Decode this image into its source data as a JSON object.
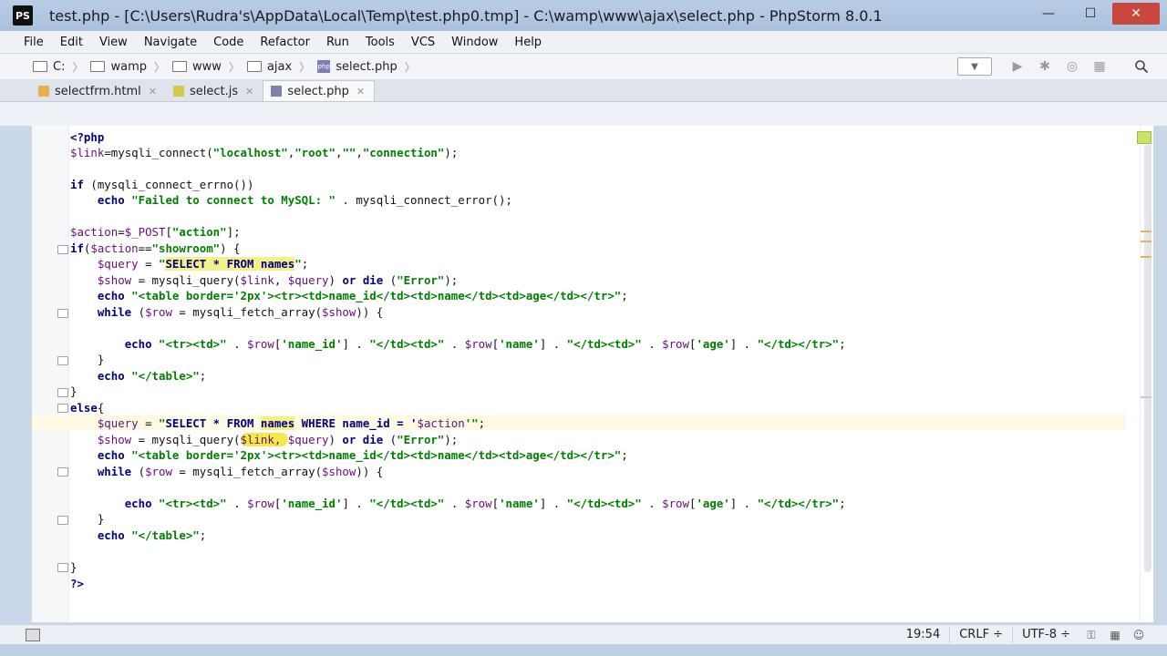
{
  "window": {
    "title": "test.php - [C:\\Users\\Rudra's\\AppData\\Local\\Temp\\test.php0.tmp] - C:\\wamp\\www\\ajax\\select.php - PhpStorm 8.0.1",
    "logo": "PS",
    "controls": {
      "minimize": "—",
      "maximize": "☐",
      "close": "✕"
    }
  },
  "menu": [
    "File",
    "Edit",
    "View",
    "Navigate",
    "Code",
    "Refactor",
    "Run",
    "Tools",
    "VCS",
    "Window",
    "Help"
  ],
  "breadcrumbs": [
    "C:",
    "wamp",
    "www",
    "ajax",
    "select.php"
  ],
  "tabs": [
    {
      "label": "selectfrm.html",
      "icon": "html-file-icon",
      "active": false
    },
    {
      "label": "select.js",
      "icon": "js-file-icon",
      "active": false
    },
    {
      "label": "select.php",
      "icon": "php-file-icon",
      "active": true
    }
  ],
  "code": {
    "l1": "<?php",
    "l2a": "$link",
    "l2b": "=mysqli_connect(",
    "l2c": "\"localhost\"",
    "l2d": ",",
    "l2e": "\"root\"",
    "l2f": ",",
    "l2g": "\"\"",
    "l2h": ",",
    "l2i": "\"connection\"",
    "l2j": ");",
    "l4a": "if",
    "l4b": " (mysqli_connect_errno())",
    "l5a": "    ",
    "l5b": "echo",
    "l5c": " ",
    "l5d": "\"Failed to connect to MySQL: \"",
    "l5e": " . mysqli_connect_error();",
    "l7a": "$action",
    "l7b": "=",
    "l7c": "$_POST",
    "l7d": "[",
    "l7e": "\"action\"",
    "l7f": "];",
    "l8a": "if",
    "l8b": "(",
    "l8c": "$action",
    "l8d": "==",
    "l8e": "\"showroom\"",
    "l8f": ") {",
    "l9a": "    ",
    "l9b": "$query",
    "l9c": " = ",
    "l9d": "\"",
    "l9e": "SELECT * FROM names",
    "l9f": "\"",
    "l9g": ";",
    "l10a": "    ",
    "l10b": "$show",
    "l10c": " = mysqli_query(",
    "l10d": "$link",
    "l10e": ", ",
    "l10f": "$query",
    "l10g": ") ",
    "l10h": "or die",
    "l10i": " (",
    "l10j": "\"Error\"",
    "l10k": ");",
    "l11a": "    ",
    "l11b": "echo",
    "l11c": " ",
    "l11d": "\"<table border='2px'><tr><td>name_id</td><td>name</td><td>age</td></tr>\"",
    "l11e": ";",
    "l12a": "    ",
    "l12b": "while",
    "l12c": " (",
    "l12d": "$row",
    "l12e": " = mysqli_fetch_array(",
    "l12f": "$show",
    "l12g": ")) {",
    "l14a": "        ",
    "l14b": "echo",
    "l14c": " ",
    "l14d": "\"<tr><td>\"",
    "l14e": " . ",
    "l14f": "$row",
    "l14g": "[",
    "l14h": "'name_id'",
    "l14i": "] . ",
    "l14j": "\"</td><td>\"",
    "l14k": " . ",
    "l14l": "$row",
    "l14m": "[",
    "l14n": "'name'",
    "l14o": "] . ",
    "l14p": "\"</td><td>\"",
    "l14q": " . ",
    "l14r": "$row",
    "l14s": "[",
    "l14t": "'age'",
    "l14u": "] . ",
    "l14v": "\"</td></tr>\"",
    "l14w": ";",
    "l15": "    }",
    "l16a": "    ",
    "l16b": "echo",
    "l16c": " ",
    "l16d": "\"</table>\"",
    "l16e": ";",
    "l17": "}",
    "l18a": "else",
    "l18b": "{",
    "l19a": "    ",
    "l19b": "$query",
    "l19c": " = ",
    "l19d": "\"",
    "l19e": "SELECT * FROM ",
    "l19f": "names",
    "l19g": " WHERE name_id = '",
    "l19h": "$action",
    "l19i": "'\"",
    "l19j": ";",
    "l20a": "    ",
    "l20b": "$show",
    "l20c": " = mysqli_query(",
    "l20d": "$link, ",
    "l20e": "$query",
    "l20f": ") ",
    "l20g": "or die",
    "l20h": " (",
    "l20i": "\"Error\"",
    "l20j": ");",
    "l21a": "    ",
    "l21b": "echo",
    "l21c": " ",
    "l21d": "\"<table border='2px'><tr><td>name_id</td><td>name</td><td>age</td></tr>\"",
    "l21e": ";",
    "l22a": "    ",
    "l22b": "while",
    "l22c": " (",
    "l22d": "$row",
    "l22e": " = mysqli_fetch_array(",
    "l22f": "$show",
    "l22g": ")) {",
    "l24a": "        ",
    "l24b": "echo",
    "l24c": " ",
    "l24d": "\"<tr><td>\"",
    "l24e": " . ",
    "l24f": "$row",
    "l24g": "[",
    "l24h": "'name_id'",
    "l24i": "] . ",
    "l24j": "\"</td><td>\"",
    "l24k": " . ",
    "l24l": "$row",
    "l24m": "[",
    "l24n": "'name'",
    "l24o": "] . ",
    "l24p": "\"</td><td>\"",
    "l24q": " . ",
    "l24r": "$row",
    "l24s": "[",
    "l24t": "'age'",
    "l24u": "] . ",
    "l24v": "\"</td></tr>\"",
    "l24w": ";",
    "l25": "    }",
    "l26a": "    ",
    "l26b": "echo",
    "l26c": " ",
    "l26d": "\"</table>\"",
    "l26e": ";",
    "l28": "}",
    "l29": "?>"
  },
  "status": {
    "position": "19:54",
    "line_separator": "CRLF ÷",
    "encoding": "UTF-8 ÷"
  },
  "colors": {
    "keyword": "#000080",
    "string": "#008000",
    "variable": "#660e7a",
    "current_line": "#fffae3",
    "title_bar": "#b9cde6"
  }
}
